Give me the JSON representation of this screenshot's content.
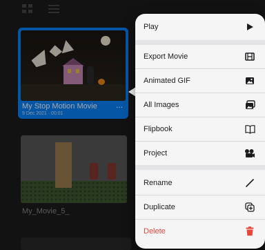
{
  "toolbar": {
    "grid_icon": "grid-icon",
    "list_icon": "list-icon"
  },
  "movies": [
    {
      "title": "My Stop Motion Movie",
      "date": "9 Dec 2021 · 00:01",
      "more": "...",
      "selected": true
    },
    {
      "title": "My_Movie_5_"
    }
  ],
  "menu": {
    "items": [
      {
        "label": "Play",
        "icon": "play-icon"
      },
      {
        "label": "Export Movie",
        "icon": "film-icon"
      },
      {
        "label": "Animated GIF",
        "icon": "image-icon"
      },
      {
        "label": "All Images",
        "icon": "images-icon"
      },
      {
        "label": "Flipbook",
        "icon": "book-icon"
      },
      {
        "label": "Project",
        "icon": "camera-reel-icon"
      },
      {
        "label": "Rename",
        "icon": "pencil-icon"
      },
      {
        "label": "Duplicate",
        "icon": "duplicate-icon"
      },
      {
        "label": "Delete",
        "icon": "trash-icon"
      }
    ]
  },
  "colors": {
    "accent": "#0a84ff",
    "menu_background": "#f5f5f5",
    "danger": "#e5473d"
  }
}
